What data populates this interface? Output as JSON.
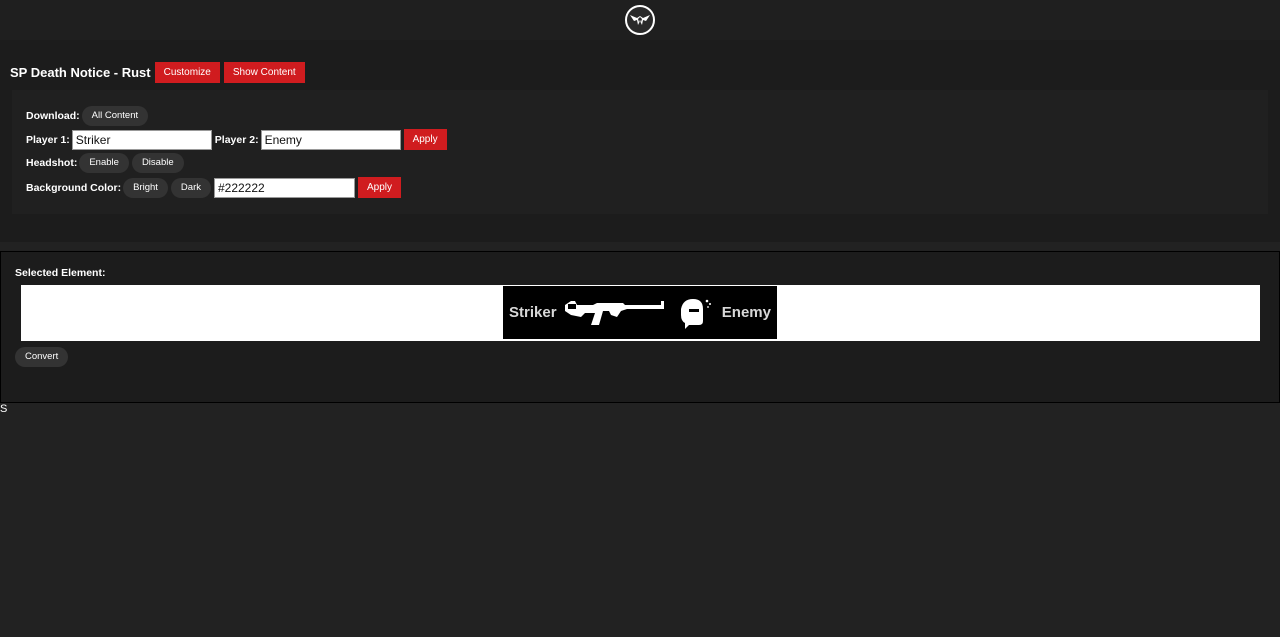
{
  "header": {
    "logo_icon": "winged-m-logo-icon"
  },
  "title_bar": {
    "title": "SP Death Notice - Rust",
    "customize_label": "Customize",
    "show_content_label": "Show Content"
  },
  "settings": {
    "download_label": "Download:",
    "all_content_label": "All Content",
    "player1_label": "Player 1:",
    "player1_value": "Striker",
    "player2_label": "Player 2:",
    "player2_value": "Enemy",
    "apply_players_label": "Apply",
    "headshot_label": "Headshot:",
    "enable_label": "Enable",
    "disable_label": "Disable",
    "bg_color_label": "Background Color:",
    "bright_label": "Bright",
    "dark_label": "Dark",
    "bg_color_value": "#222222",
    "apply_bg_label": "Apply"
  },
  "selected": {
    "label": "Selected Element:",
    "notice": {
      "killer": "Striker",
      "victim": "Enemy",
      "weapon_icon": "assault-rifle-icon",
      "headshot_icon": "headshot-helmet-icon"
    },
    "convert_label": "Convert"
  },
  "stray_text": "S",
  "colors": {
    "accent": "#d01c1f",
    "background": "#222222",
    "pill": "#333333"
  }
}
